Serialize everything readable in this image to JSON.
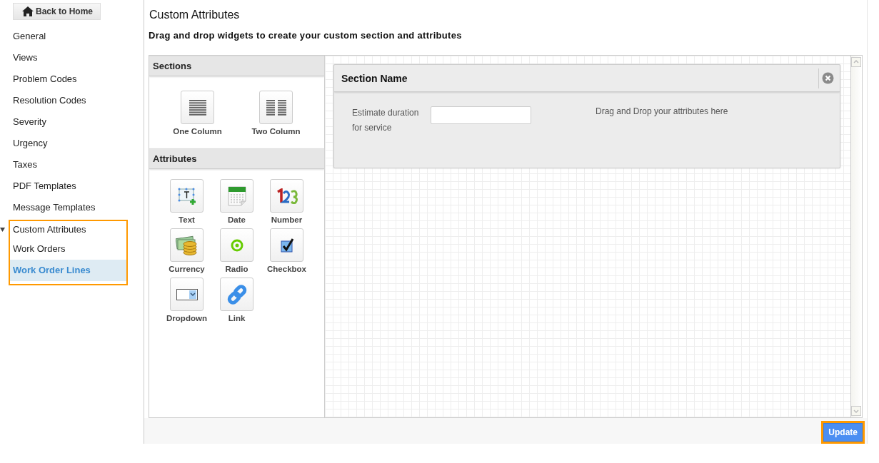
{
  "sidebar": {
    "back_button": "Back to Home",
    "items": [
      {
        "label": "General",
        "selected": false
      },
      {
        "label": "Views",
        "selected": false
      },
      {
        "label": "Problem Codes",
        "selected": false
      },
      {
        "label": "Resolution Codes",
        "selected": false
      },
      {
        "label": "Severity",
        "selected": false
      },
      {
        "label": "Urgency",
        "selected": false
      },
      {
        "label": "Taxes",
        "selected": false
      },
      {
        "label": "PDF Templates",
        "selected": false
      },
      {
        "label": "Message Templates",
        "selected": false
      },
      {
        "label": "Custom Attributes",
        "selected": false,
        "expanded": true,
        "highlighted": true,
        "children": [
          {
            "label": "Work Orders",
            "selected": false
          },
          {
            "label": "Work Order Lines",
            "selected": true
          }
        ]
      }
    ]
  },
  "page": {
    "title": "Custom Attributes",
    "subtitle": "Drag and drop widgets to create your custom section and attributes"
  },
  "palette": {
    "sections_title": "Sections",
    "sections": [
      {
        "label": "One Column",
        "kind": "one"
      },
      {
        "label": "Two Column",
        "kind": "two"
      }
    ],
    "attributes_title": "Attributes",
    "attributes": [
      {
        "label": "Text",
        "kind": "text"
      },
      {
        "label": "Date",
        "kind": "date"
      },
      {
        "label": "Number",
        "kind": "number"
      },
      {
        "label": "Currency",
        "kind": "currency"
      },
      {
        "label": "Radio",
        "kind": "radio"
      },
      {
        "label": "Checkbox",
        "kind": "checkbox"
      },
      {
        "label": "Dropdown",
        "kind": "dropdown"
      },
      {
        "label": "Link",
        "kind": "link"
      }
    ]
  },
  "section": {
    "title": "Section Name",
    "field_label": "Estimate  duration for service",
    "drop_hint": "Drag and Drop your attributes here"
  },
  "update_button": {
    "label": "Update",
    "highlighted": true
  }
}
